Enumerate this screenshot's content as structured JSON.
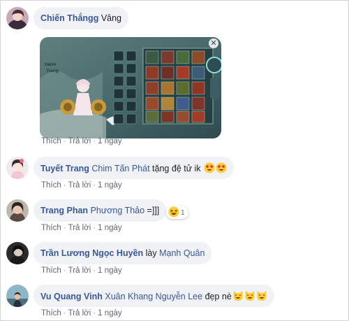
{
  "comments": [
    {
      "author": "Chiến Thắngg",
      "mentions": [],
      "text": "Vâng",
      "has_image": true,
      "image_captions": [
        "Hành",
        "Trang"
      ],
      "actions": {
        "like": "Thích",
        "reply": "Trả lời",
        "time": "1 ngày"
      }
    },
    {
      "author": "Tuyết Trang",
      "mentions": [
        "Chim Tấn Phát"
      ],
      "text": "tặng đệ tử ik",
      "emojis": [
        "heart-eyes",
        "heart-eyes"
      ],
      "actions": {
        "like": "Thích",
        "reply": "Trả lời",
        "time": "1 ngày"
      }
    },
    {
      "author": "Trang Phan",
      "mentions": [
        "Phương Thảo"
      ],
      "text": "=]]]",
      "reaction": {
        "emoji": "laughing",
        "count": "1"
      },
      "actions": {
        "like": "Thích",
        "reply": "Trả lời",
        "time": "1 ngày"
      }
    },
    {
      "author": "Trần Lương Ngọc Huyền",
      "mentions": [],
      "text": "lày",
      "mention_after": "Mạnh Quân",
      "actions": {
        "like": "Thích",
        "reply": "Trả lời",
        "time": "1 ngày"
      }
    },
    {
      "author": "Vu Quang Vinh",
      "mentions": [
        "Xuân Khang Nguyễn Lee"
      ],
      "text": "đẹp nè",
      "emojis": [
        "smiling-cat",
        "smiling-cat",
        "smiling-cat"
      ],
      "actions": {
        "like": "Thích",
        "reply": "Trả lời",
        "time": "1 ngày"
      }
    }
  ],
  "colors": {
    "link_name": "#385898",
    "bubble_bg": "#f0f2f5",
    "meta_text": "#606770",
    "emoji_face": "#ffcc33",
    "heart": "#f0284a"
  }
}
